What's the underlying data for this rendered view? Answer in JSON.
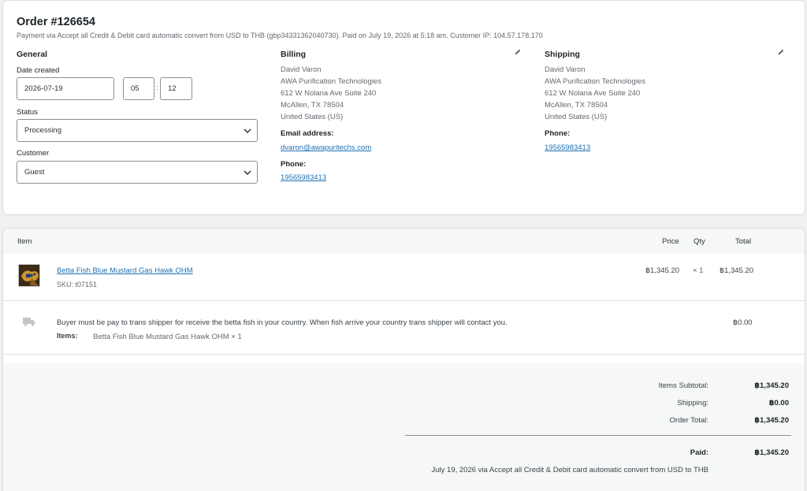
{
  "order": {
    "title": "Order #126654",
    "subtitle": "Payment via Accept all Credit & Debit card automatic convert from USD to THB (gbp34331362040730). Paid on July 19, 2026 at 5:18 am. Customer IP: 104.57.178.170"
  },
  "general": {
    "heading": "General",
    "date_label": "Date created",
    "date_value": "2026-07-19",
    "hour_value": "05",
    "time_sep": ":",
    "minute_value": "12",
    "status_label": "Status",
    "status_value": "Processing",
    "customer_label": "Customer",
    "customer_value": "Guest"
  },
  "billing": {
    "heading": "Billing",
    "name": "David Varon",
    "company": "AWA Purification Technologies",
    "address1": "612 W Nolana Ave Suite 240",
    "city_line": "McAllen, TX 78504",
    "country": "United States (US)",
    "email_label": "Email address:",
    "email": "dvaron@awapuritechs.com",
    "phone_label": "Phone:",
    "phone": "19565983413"
  },
  "shipping": {
    "heading": "Shipping",
    "name": "David Varon",
    "company": "AWA Purification Technologies",
    "address1": "612 W Nolana Ave Suite 240",
    "city_line": "McAllen, TX 78504",
    "country": "United States (US)",
    "phone_label": "Phone:",
    "phone": "19565983413"
  },
  "items_table": {
    "headers": {
      "item": "Item",
      "price": "Price",
      "qty": "Qty",
      "total": "Total"
    },
    "line_item": {
      "name": "Betta Fish Blue Mustard Gas Hawk OHM",
      "sku": "SKU: t07151",
      "price": "฿1,345.20",
      "qty": "× 1",
      "total": "฿1,345.20"
    },
    "shipping_line": {
      "note": "Buyer must be pay to trans shipper for receive the betta fish in your country. When fish arrive your country trans shipper will contact you.",
      "items_label": "Items:",
      "items_value": "Betta Fish Blue Mustard Gas Hawk OHM × 1",
      "cost": "฿0.00"
    }
  },
  "totals": {
    "subtotal_label": "Items Subtotal:",
    "subtotal_value": "฿1,345.20",
    "shipping_label": "Shipping:",
    "shipping_value": "฿0.00",
    "order_total_label": "Order Total:",
    "order_total_value": "฿1,345.20",
    "paid_label": "Paid:",
    "paid_value": "฿1,345.20",
    "paid_note": "July 19, 2026 via Accept all Credit & Debit card automatic convert from USD to THB"
  },
  "icons": {
    "edit": "pencil-icon",
    "chevron": "chevron-down-icon",
    "shipping": "truck-icon"
  },
  "colors": {
    "link": "#2271b1",
    "background": "#f0f0f1"
  }
}
